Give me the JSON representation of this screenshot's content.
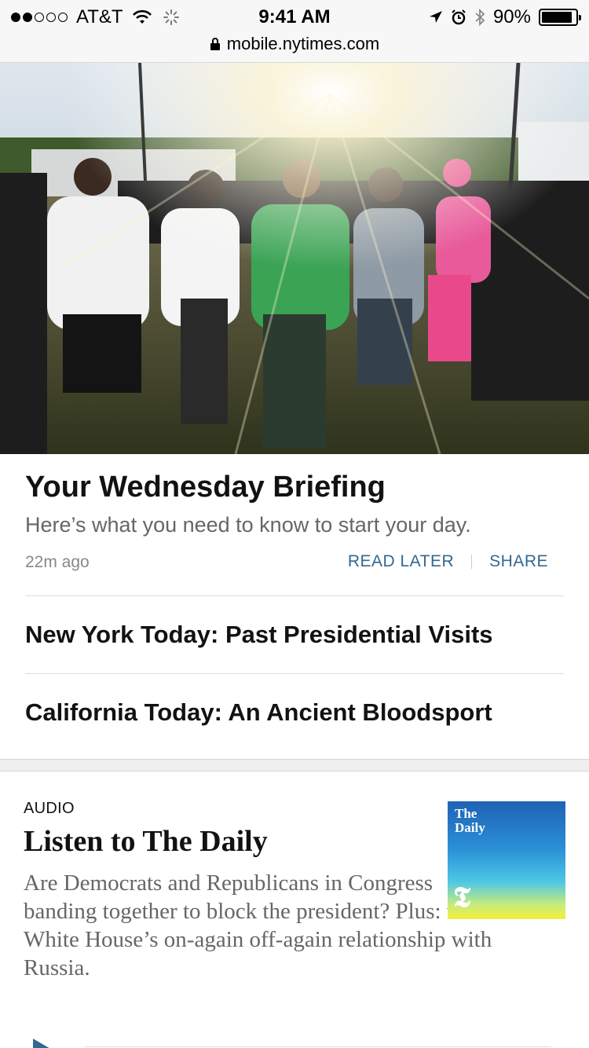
{
  "status_bar": {
    "carrier": "AT&T",
    "time": "9:41 AM",
    "battery": "90%",
    "battery_level": 0.9,
    "url": "mobile.nytimes.com",
    "icons": [
      "wifi-icon",
      "activity-spinner-icon",
      "location-arrow-icon",
      "alarm-icon",
      "bluetooth-icon",
      "lock-icon"
    ]
  },
  "hero": {
    "icon": "photo-people-holding-hands-vigil"
  },
  "briefing": {
    "headline": "Your Wednesday Briefing",
    "summary": "Here’s what you need to know to start your day.",
    "timestamp": "22m ago",
    "read_later": "READ LATER",
    "share": "SHARE"
  },
  "related": [
    {
      "title": "New York Today: Past Presidential Visits"
    },
    {
      "title": "California Today: An Ancient Bloodsport"
    }
  ],
  "audio": {
    "kicker": "AUDIO",
    "title": "Listen to The Daily",
    "body": "Are Democrats and Republicans in Congress banding together to block the president? Plus: the White House’s on-again off-again relationship with Russia.",
    "thumb_title": "The\nDaily",
    "thumb_logo": "𝕿"
  },
  "colors": {
    "accent": "#326891",
    "text": "#121212",
    "muted": "#666666"
  }
}
